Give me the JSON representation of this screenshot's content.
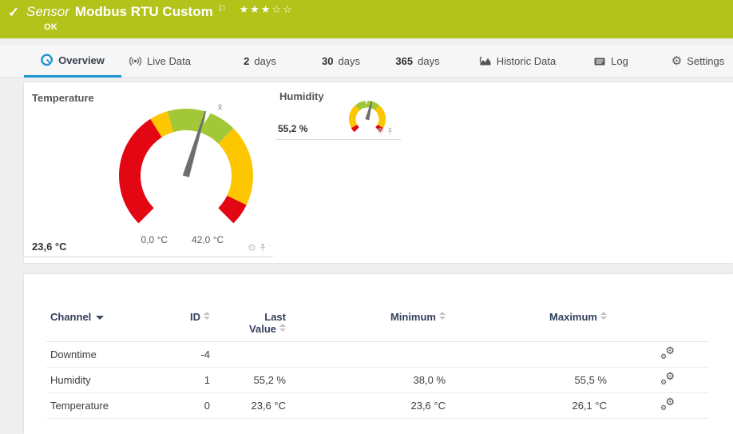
{
  "colors": {
    "header_bg": "#b3c31a",
    "accent_blue": "#1b95d1",
    "gauge_red": "#e30613",
    "gauge_yellow": "#fcc700",
    "gauge_green": "#a2c837",
    "needle_gray": "#6e6e6e"
  },
  "header": {
    "kind": "Sensor",
    "title": "Modbus RTU Custom",
    "status": "OK",
    "check_icon": "✓",
    "flag_icon": "⚐",
    "stars_filled": "★★★",
    "stars_empty": "☆☆"
  },
  "tabs": [
    {
      "label": "Overview",
      "active": true
    },
    {
      "label": "Live Data"
    },
    {
      "count": "2",
      "label": "days"
    },
    {
      "count": "30",
      "label": "days"
    },
    {
      "count": "365",
      "label": "days"
    },
    {
      "label": "Historic Data"
    },
    {
      "label": "Log"
    },
    {
      "label": "Settings"
    }
  ],
  "gauges": {
    "temperature": {
      "label": "Temperature",
      "min": 0,
      "max": 42,
      "value": 23.6,
      "mean": 24,
      "min_label": "0,0 °C",
      "max_label": "42,0 °C",
      "value_label": "23,6 °C",
      "mean_label": "x̄",
      "segments": [
        {
          "from": 0,
          "to": 16,
          "color": "#e30613"
        },
        {
          "from": 16,
          "to": 18.5,
          "color": "#fcc700"
        },
        {
          "from": 18.5,
          "to": 28,
          "color": "#a2c837"
        },
        {
          "from": 28,
          "to": 39,
          "color": "#fcc700"
        },
        {
          "from": 39,
          "to": 42,
          "color": "#e30613"
        }
      ]
    },
    "humidity": {
      "label": "Humidity",
      "min": 0,
      "max": 100,
      "value": 55.2,
      "mean": 49,
      "value_label": "55,2 %",
      "segments": [
        {
          "from": 0,
          "to": 6,
          "color": "#e30613"
        },
        {
          "from": 6,
          "to": 35,
          "color": "#fcc700"
        },
        {
          "from": 35,
          "to": 65,
          "color": "#a2c837"
        },
        {
          "from": 65,
          "to": 94,
          "color": "#fcc700"
        },
        {
          "from": 94,
          "to": 100,
          "color": "#e30613"
        }
      ]
    }
  },
  "table": {
    "headers": {
      "channel": "Channel",
      "id": "ID",
      "last_line1": "Last",
      "last_line2": "Value",
      "minimum": "Minimum",
      "maximum": "Maximum"
    },
    "rows": [
      {
        "channel": "Downtime",
        "id": "-4",
        "last": "",
        "min": "",
        "max": ""
      },
      {
        "channel": "Humidity",
        "id": "1",
        "last": "55,2 %",
        "min": "38,0 %",
        "max": "55,5 %"
      },
      {
        "channel": "Temperature",
        "id": "0",
        "last": "23,6 °C",
        "min": "23,6 °C",
        "max": "26,1 °C"
      }
    ]
  }
}
